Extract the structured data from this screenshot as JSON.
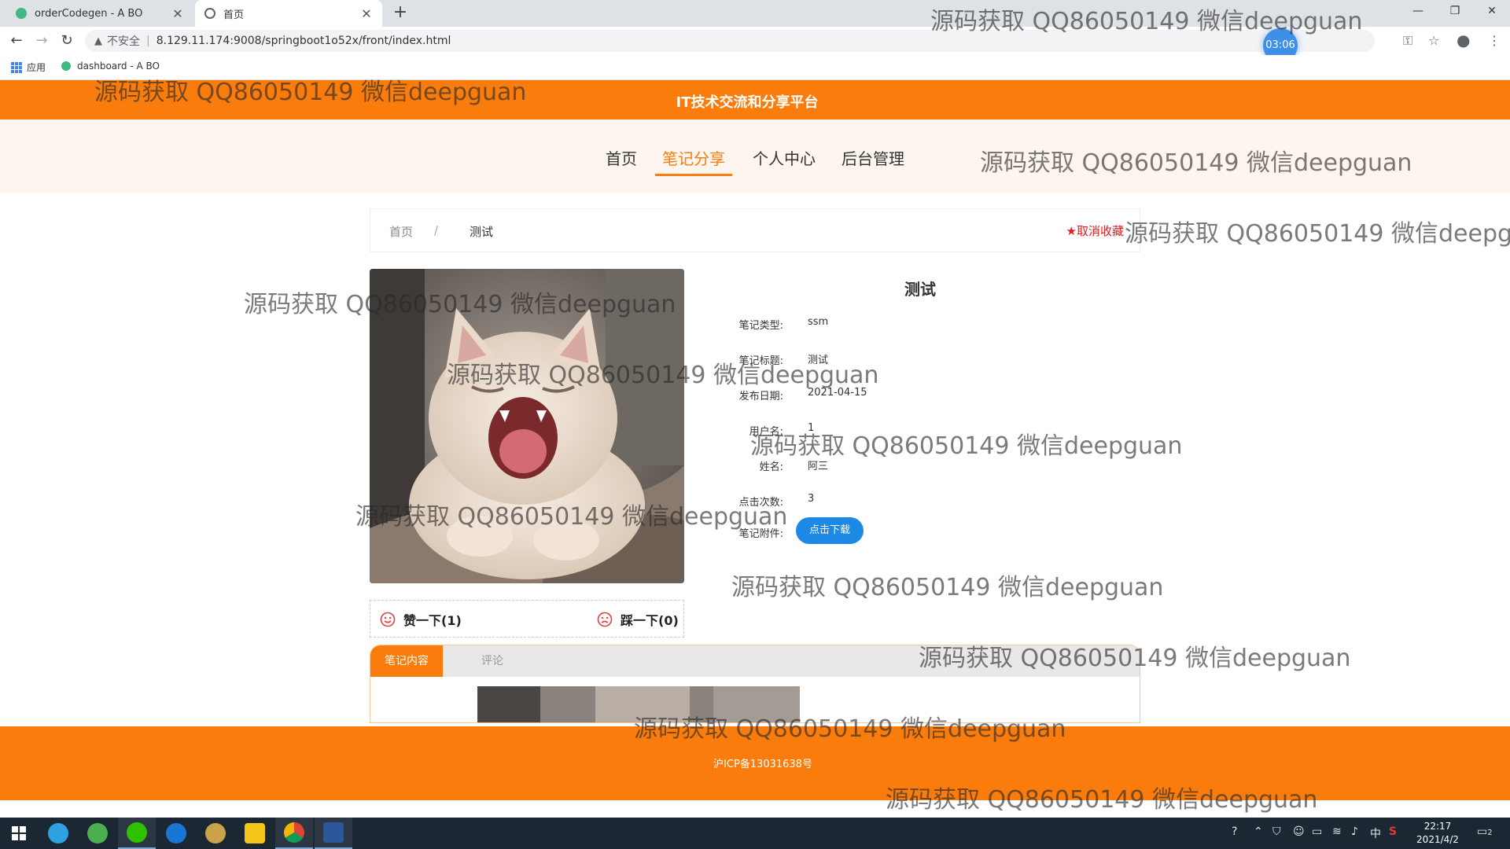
{
  "browser": {
    "tabs": [
      {
        "title": "orderCodegen - A BO",
        "active": false
      },
      {
        "title": "首页",
        "active": true
      }
    ],
    "url_security": "不安全",
    "url": "8.129.11.174:9008/springboot1o52x/front/index.html",
    "timer": "03:06",
    "bookmarks": [
      {
        "label": "应用",
        "icon": "apps-grid-icon"
      },
      {
        "label": "dashboard - A BO",
        "icon": "vue-logo-icon"
      }
    ]
  },
  "site": {
    "title": "IT技术交流和分享平台",
    "nav": [
      {
        "label": "首页",
        "active": false
      },
      {
        "label": "笔记分享",
        "active": true
      },
      {
        "label": "个人中心",
        "active": false
      },
      {
        "label": "后台管理",
        "active": false
      }
    ]
  },
  "breadcrumb": {
    "home": "首页",
    "separator": "/",
    "current": "测试",
    "favorite": "取消收藏"
  },
  "votes": {
    "like": "赞一下(1)",
    "dislike": "踩一下(0)"
  },
  "detail": {
    "title": "测试",
    "fields": [
      {
        "label": "笔记类型:",
        "value": "ssm"
      },
      {
        "label": "笔记标题:",
        "value": "测试"
      },
      {
        "label": "发布日期:",
        "value": "2021-04-15"
      },
      {
        "label": "用户名:",
        "value": "1"
      },
      {
        "label": "姓名:",
        "value": "阿三"
      },
      {
        "label": "点击次数:",
        "value": "3"
      }
    ],
    "attachment_label": "笔记附件:",
    "download_button": "点击下载"
  },
  "content_tabs": [
    {
      "label": "笔记内容",
      "active": true
    },
    {
      "label": "评论",
      "active": false
    }
  ],
  "footer": {
    "icp": "沪ICP备13031638号"
  },
  "watermark": "源码获取 QQ86050149 微信deepguan",
  "taskbar": {
    "time": "22:17",
    "date": "2021/4/2",
    "notification_count": "2",
    "ime": "中"
  },
  "colors": {
    "brand_orange": "#f97c0c",
    "nav_bg": "#fdf5ee",
    "download_blue": "#1e88e5",
    "favorite_red": "#e21b1b"
  }
}
